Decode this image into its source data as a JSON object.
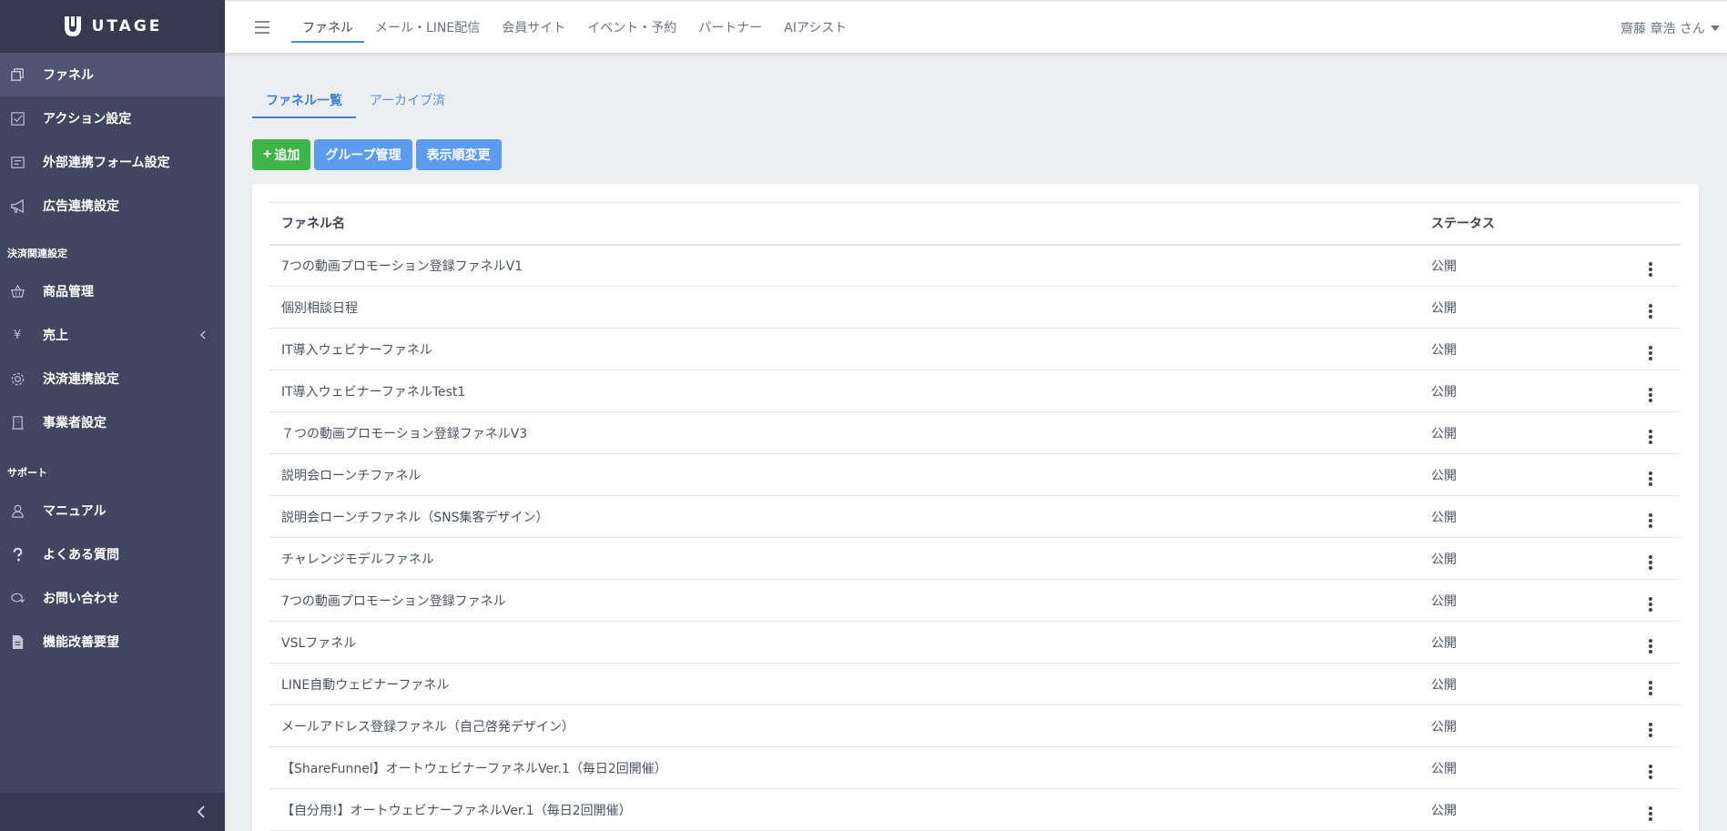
{
  "app": {
    "logo_text": "UTAGE"
  },
  "sidebar": {
    "items": [
      {
        "label": "ファネル",
        "icon": "copy-icon"
      },
      {
        "label": "アクション設定",
        "icon": "check-square-icon"
      },
      {
        "label": "外部連携フォーム設定",
        "icon": "form-icon"
      },
      {
        "label": "広告連携設定",
        "icon": "megaphone-icon"
      }
    ],
    "section_payment": "決済関連設定",
    "payment_items": [
      {
        "label": "商品管理",
        "icon": "basket-icon"
      },
      {
        "label": "売上",
        "icon": "yen-icon"
      },
      {
        "label": "決済連携設定",
        "icon": "gear-icon"
      },
      {
        "label": "事業者設定",
        "icon": "building-icon"
      }
    ],
    "section_support": "サポート",
    "support_items": [
      {
        "label": "マニュアル",
        "icon": "person-icon"
      },
      {
        "label": "よくある質問",
        "icon": "question-icon"
      },
      {
        "label": "お問い合わせ",
        "icon": "chat-icon"
      },
      {
        "label": "機能改善要望",
        "icon": "document-icon"
      }
    ],
    "yen_glyph": "¥"
  },
  "topbar": {
    "tabs": [
      "ファネル",
      "メール・LINE配信",
      "会員サイト",
      "イベント・予約",
      "パートナー",
      "AIアシスト"
    ],
    "user": "齋藤 章浩 さん"
  },
  "main": {
    "sub_tabs": [
      "ファネル一覧",
      "アーカイブ済"
    ],
    "buttons": {
      "add": "追加",
      "add_plus": "+",
      "group": "グループ管理",
      "order": "表示順変更"
    },
    "table": {
      "headers": {
        "name": "ファネル名",
        "status": "ステータス"
      },
      "rows": [
        {
          "name": "7つの動画プロモーション登録ファネルV1",
          "status": "公開"
        },
        {
          "name": "個別相談日程",
          "status": "公開"
        },
        {
          "name": "IT導入ウェビナーファネル",
          "status": "公開"
        },
        {
          "name": "IT導入ウェビナーファネルTest1",
          "status": "公開"
        },
        {
          "name": "７つの動画プロモーション登録ファネルV3",
          "status": "公開"
        },
        {
          "name": "説明会ローンチファネル",
          "status": "公開"
        },
        {
          "name": "説明会ローンチファネル（SNS集客デザイン）",
          "status": "公開"
        },
        {
          "name": "チャレンジモデルファネル",
          "status": "公開"
        },
        {
          "name": "7つの動画プロモーション登録ファネル",
          "status": "公開"
        },
        {
          "name": "VSLファネル",
          "status": "公開"
        },
        {
          "name": "LINE自動ウェビナーファネル",
          "status": "公開"
        },
        {
          "name": "メールアドレス登録ファネル（自己啓発デザイン）",
          "status": "公開"
        },
        {
          "name": "【ShareFunnel】オートウェビナーファネルVer.1（毎日2回開催）",
          "status": "公開"
        },
        {
          "name": "【自分用!】オートウェビナーファネルVer.1（毎日2回開催）",
          "status": "公開"
        }
      ]
    }
  }
}
